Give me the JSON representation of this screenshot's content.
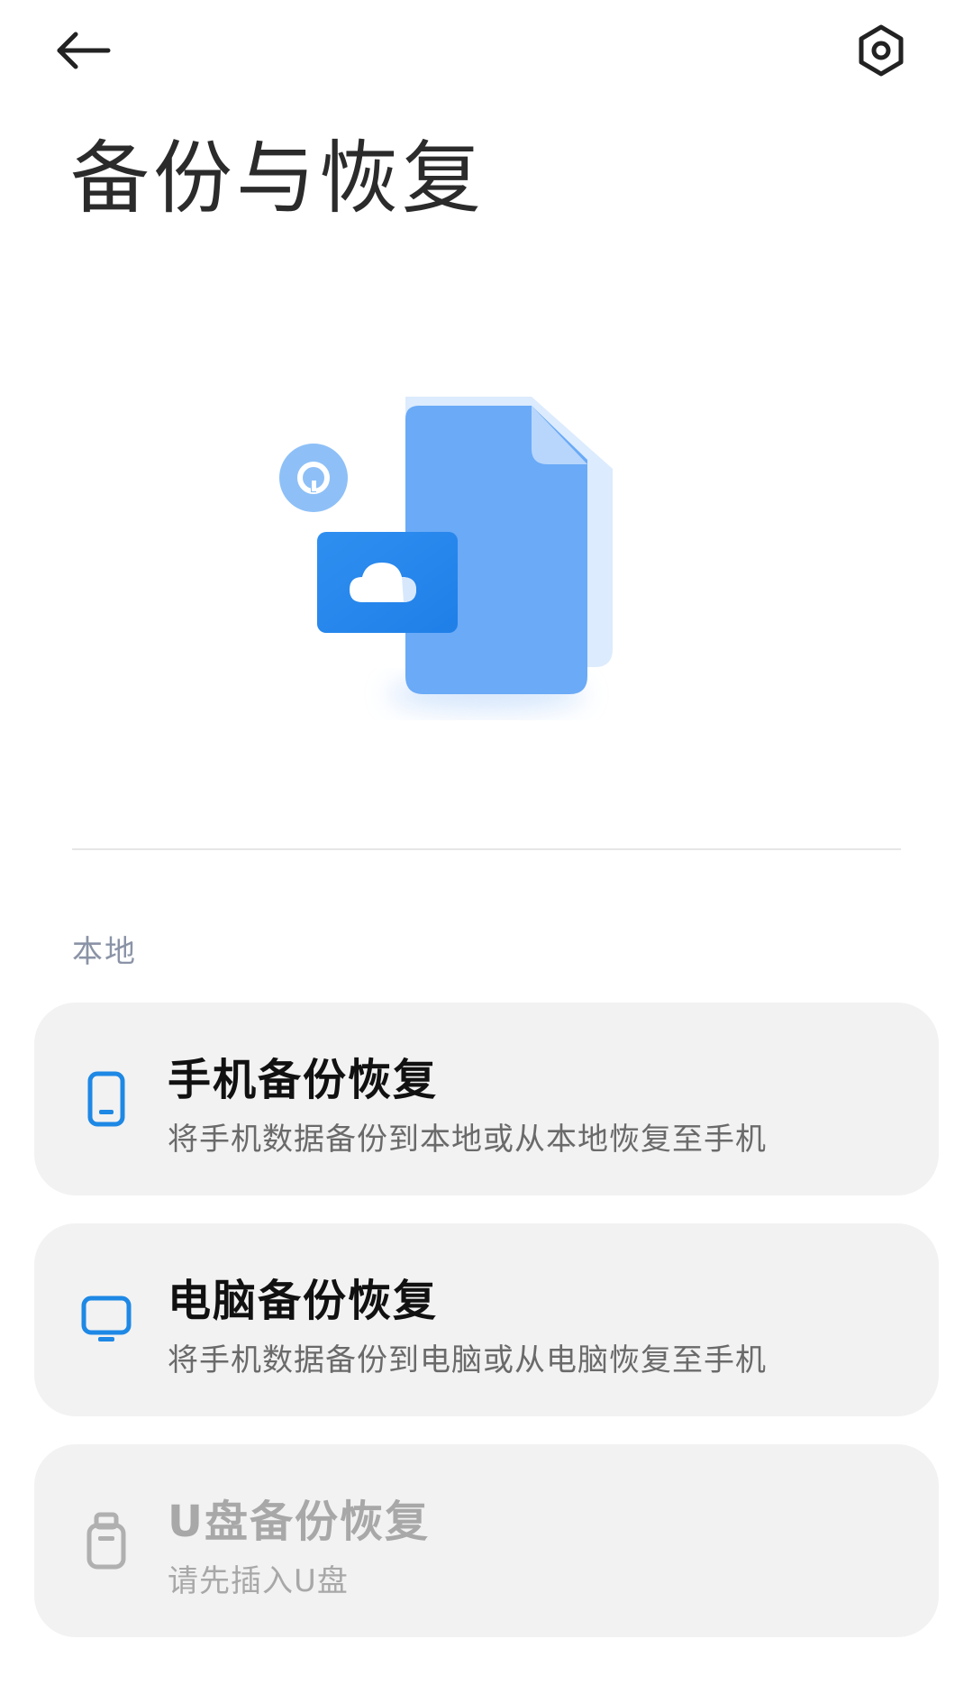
{
  "header": {
    "title": "备份与恢复",
    "back_icon": "back-arrow-icon",
    "settings_icon": "settings-hexagon-icon"
  },
  "hero": {
    "illustration": "document-cloud-backup-illustration"
  },
  "local_section": {
    "label": "本地",
    "items": [
      {
        "title": "手机备份恢复",
        "subtitle": "将手机数据备份到本地或从本地恢复至手机",
        "icon": "phone-icon",
        "enabled": true
      },
      {
        "title": "电脑备份恢复",
        "subtitle": "将手机数据备份到电脑或从电脑恢复至手机",
        "icon": "monitor-icon",
        "enabled": true
      },
      {
        "title": "U盘备份恢复",
        "subtitle": "请先插入U盘",
        "icon": "usb-drive-icon",
        "enabled": false
      }
    ]
  },
  "colors": {
    "accent": "#1e88e5",
    "card_bg": "#f2f2f2",
    "section_label": "#8a93a6",
    "disabled": "#a8a8a8"
  }
}
